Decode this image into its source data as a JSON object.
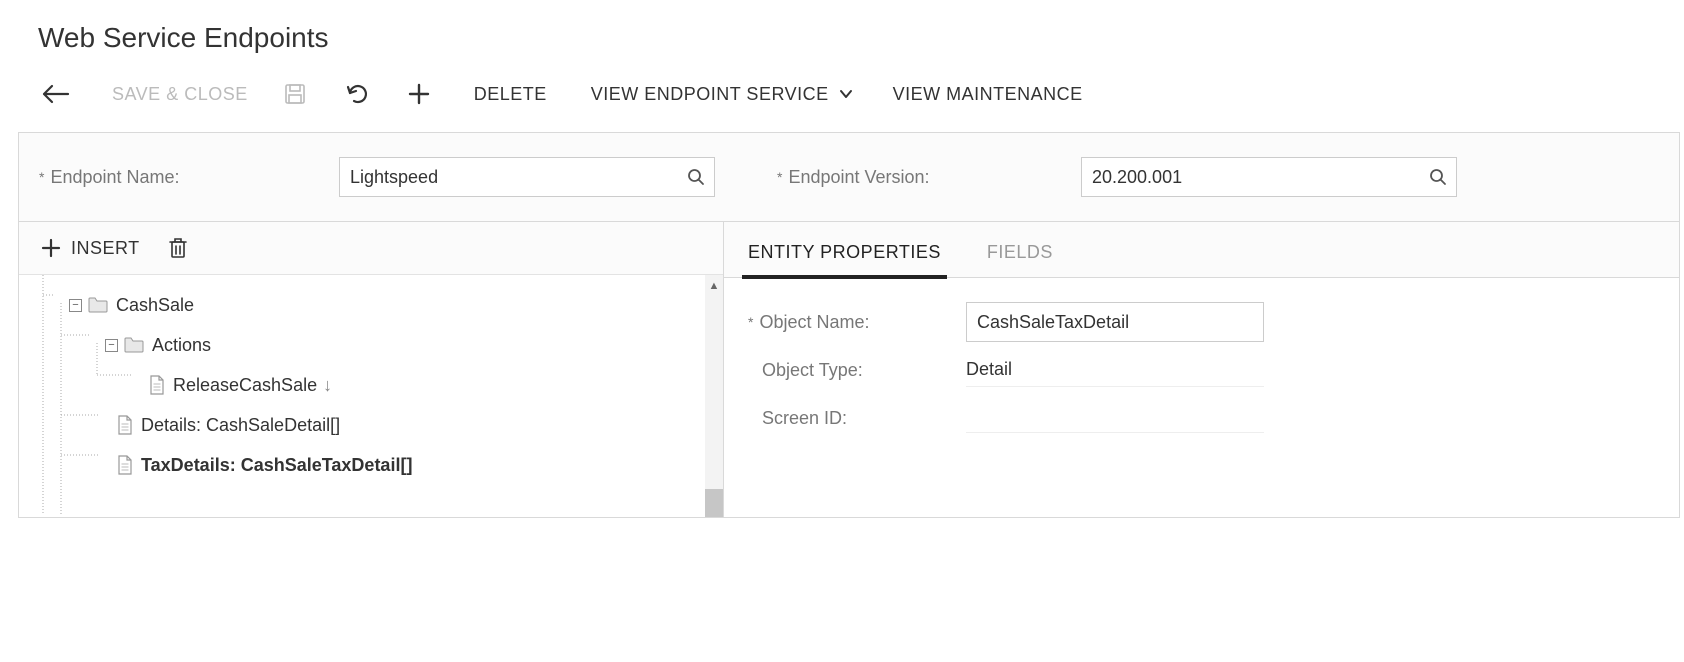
{
  "title": "Web Service Endpoints",
  "toolbar": {
    "save_close": "SAVE & CLOSE",
    "delete": "DELETE",
    "view_endpoint_service": "VIEW ENDPOINT SERVICE",
    "view_maintenance": "VIEW MAINTENANCE"
  },
  "form": {
    "endpoint_name_label": "Endpoint Name:",
    "endpoint_name_value": "Lightspeed",
    "endpoint_version_label": "Endpoint Version:",
    "endpoint_version_value": "20.200.001"
  },
  "left": {
    "insert_label": "INSERT"
  },
  "tree": {
    "node0": "CashSale",
    "node1": "Actions",
    "node2": "ReleaseCashSale",
    "node3": "Details: CashSaleDetail[]",
    "node4": "TaxDetails: CashSaleTaxDetail[]"
  },
  "tabs": {
    "entity_props": "ENTITY PROPERTIES",
    "fields": "FIELDS"
  },
  "props": {
    "object_name_label": "Object Name:",
    "object_name_value": "CashSaleTaxDetail",
    "object_type_label": "Object Type:",
    "object_type_value": "Detail",
    "screen_id_label": "Screen ID:"
  }
}
